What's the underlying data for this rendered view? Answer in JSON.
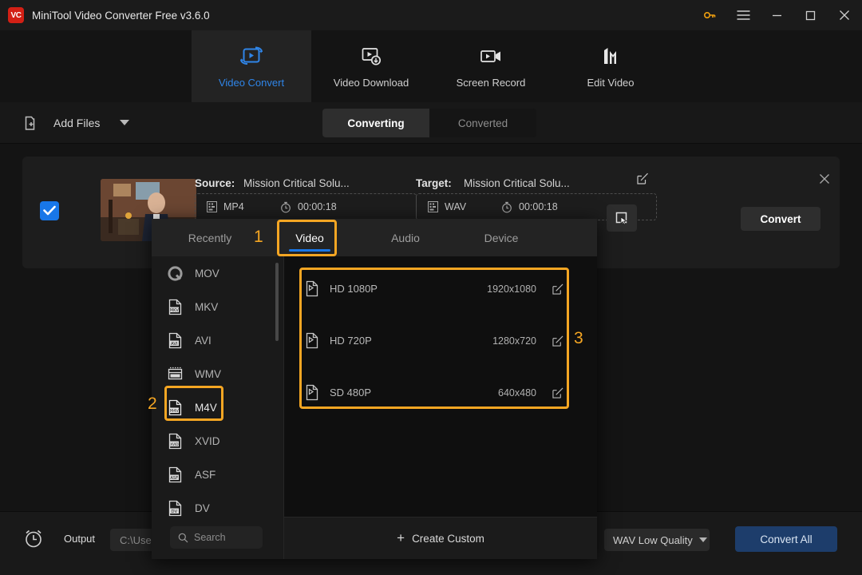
{
  "window": {
    "title": "MiniTool Video Converter Free v3.6.0",
    "logo_text": "VC",
    "controls": {
      "key": "key-icon",
      "menu": "hamburger-menu-icon",
      "minimize": "–",
      "maximize": "□",
      "close": "✕"
    }
  },
  "nav": {
    "tabs": [
      {
        "label": "Video Convert",
        "icon": "video-convert-icon",
        "active": true
      },
      {
        "label": "Video Download",
        "icon": "video-download-icon",
        "active": false
      },
      {
        "label": "Screen Record",
        "icon": "screen-record-icon",
        "active": false
      },
      {
        "label": "Edit Video",
        "icon": "edit-video-icon",
        "active": false
      }
    ]
  },
  "toolbar": {
    "add_files_label": "Add Files",
    "add_files_icon": "add-folder-icon",
    "dropdown_caret": "chevron-down-icon",
    "segments": [
      {
        "label": "Converting",
        "active": true
      },
      {
        "label": "Converted",
        "active": false
      }
    ]
  },
  "file_card": {
    "checked": true,
    "source": {
      "label": "Source:",
      "name": "Mission Critical Solu...",
      "format": "MP4",
      "duration": "00:00:18"
    },
    "target": {
      "label": "Target:",
      "name": "Mission Critical Solu...",
      "format": "WAV",
      "duration": "00:00:18"
    },
    "edit_icon": "edit-pencil-icon",
    "close_icon": "close-icon",
    "snapshot_icon": "snapshot-icon",
    "convert_label": "Convert"
  },
  "dropdown": {
    "tabs": [
      {
        "label": "Recently",
        "active": false
      },
      {
        "label": "Video",
        "active": true
      },
      {
        "label": "Audio",
        "active": false
      },
      {
        "label": "Device",
        "active": false
      }
    ],
    "formats": [
      {
        "label": "MOV",
        "icon": "quicktime-icon",
        "selected": false
      },
      {
        "label": "MKV",
        "icon": "mkv-file-icon",
        "selected": false
      },
      {
        "label": "AVI",
        "icon": "avi-file-icon",
        "selected": false
      },
      {
        "label": "WMV",
        "icon": "wmv-file-icon",
        "selected": false
      },
      {
        "label": "M4V",
        "icon": "m4v-file-icon",
        "selected": true
      },
      {
        "label": "XVID",
        "icon": "xvid-file-icon",
        "selected": false
      },
      {
        "label": "ASF",
        "icon": "asf-file-icon",
        "selected": false
      },
      {
        "label": "DV",
        "icon": "dv-file-icon",
        "selected": false
      }
    ],
    "search_placeholder": "Search",
    "search_icon": "search-icon",
    "qualities": [
      {
        "name": "HD 1080P",
        "resolution": "1920x1080",
        "icon": "video-file-icon",
        "edit_icon": "edit-icon"
      },
      {
        "name": "HD 720P",
        "resolution": "1280x720",
        "icon": "video-file-icon",
        "edit_icon": "edit-icon"
      },
      {
        "name": "SD 480P",
        "resolution": "640x480",
        "icon": "video-file-icon",
        "edit_icon": "edit-icon"
      }
    ],
    "create_custom_label": "Create Custom",
    "create_custom_icon": "plus-icon"
  },
  "annotations": [
    {
      "number": "1",
      "target": "video-tab"
    },
    {
      "number": "2",
      "target": "m4v-format-row"
    },
    {
      "number": "3",
      "target": "quality-list"
    }
  ],
  "footer": {
    "clock_icon": "alarm-clock-icon",
    "output_label": "Output",
    "output_path": "C:\\Users",
    "quality_select": "WAV Low Quality",
    "quality_caret": "chevron-down-icon",
    "convert_all_label": "Convert All"
  },
  "colors": {
    "accent_blue": "#1877e8",
    "highlight_orange": "#f5a623",
    "panel_bg": "#1a1a1a",
    "window_bg": "#141414",
    "convert_all_bg": "#1d3d6b"
  }
}
